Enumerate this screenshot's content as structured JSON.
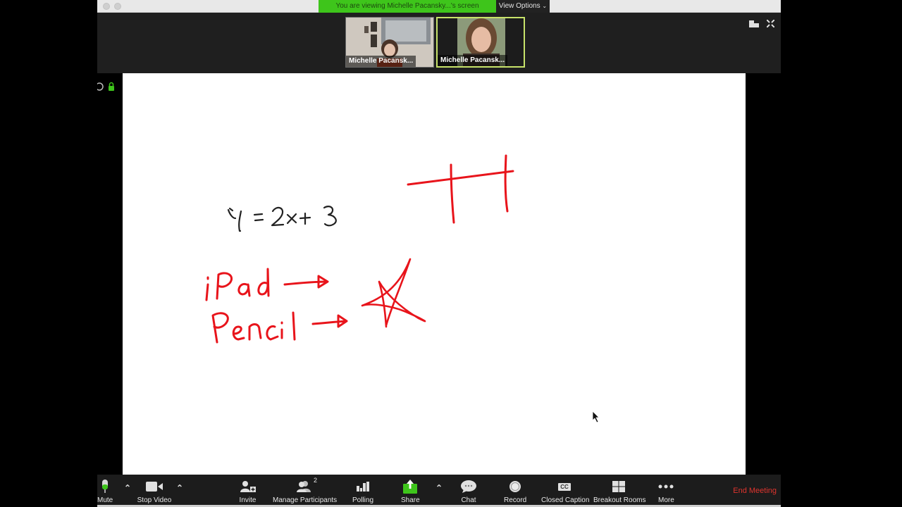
{
  "window": {
    "banner_text": "You are viewing Michelle Pacansky...'s screen",
    "view_options_label": "View Options"
  },
  "participants": [
    {
      "name": "Michelle Pacansk...",
      "active_speaker": false
    },
    {
      "name": "Michelle Pacansk...",
      "active_speaker": true
    }
  ],
  "top_right_icons": [
    "gallery-layout-icon",
    "fullscreen-icon"
  ],
  "whiteboard": {
    "ink_black": "#222222",
    "ink_red": "#e8141b",
    "handwriting": {
      "equation": "y = 2x + 3",
      "line1": "iPad",
      "line2": "Pencil"
    }
  },
  "toolbar": {
    "mute": "Mute",
    "stop_video": "Stop Video",
    "invite": "Invite",
    "manage_participants": "Manage Participants",
    "participant_count": "2",
    "polling": "Polling",
    "share": "Share",
    "chat": "Chat",
    "record": "Record",
    "closed_caption": "Closed Caption",
    "cc_badge": "CC",
    "breakout_rooms": "Breakout Rooms",
    "more": "More",
    "end_meeting": "End Meeting"
  },
  "colors": {
    "accent_green": "#3ec51b",
    "end_meeting_red": "#e0342e",
    "toolbar_bg": "#1c1c1c"
  }
}
